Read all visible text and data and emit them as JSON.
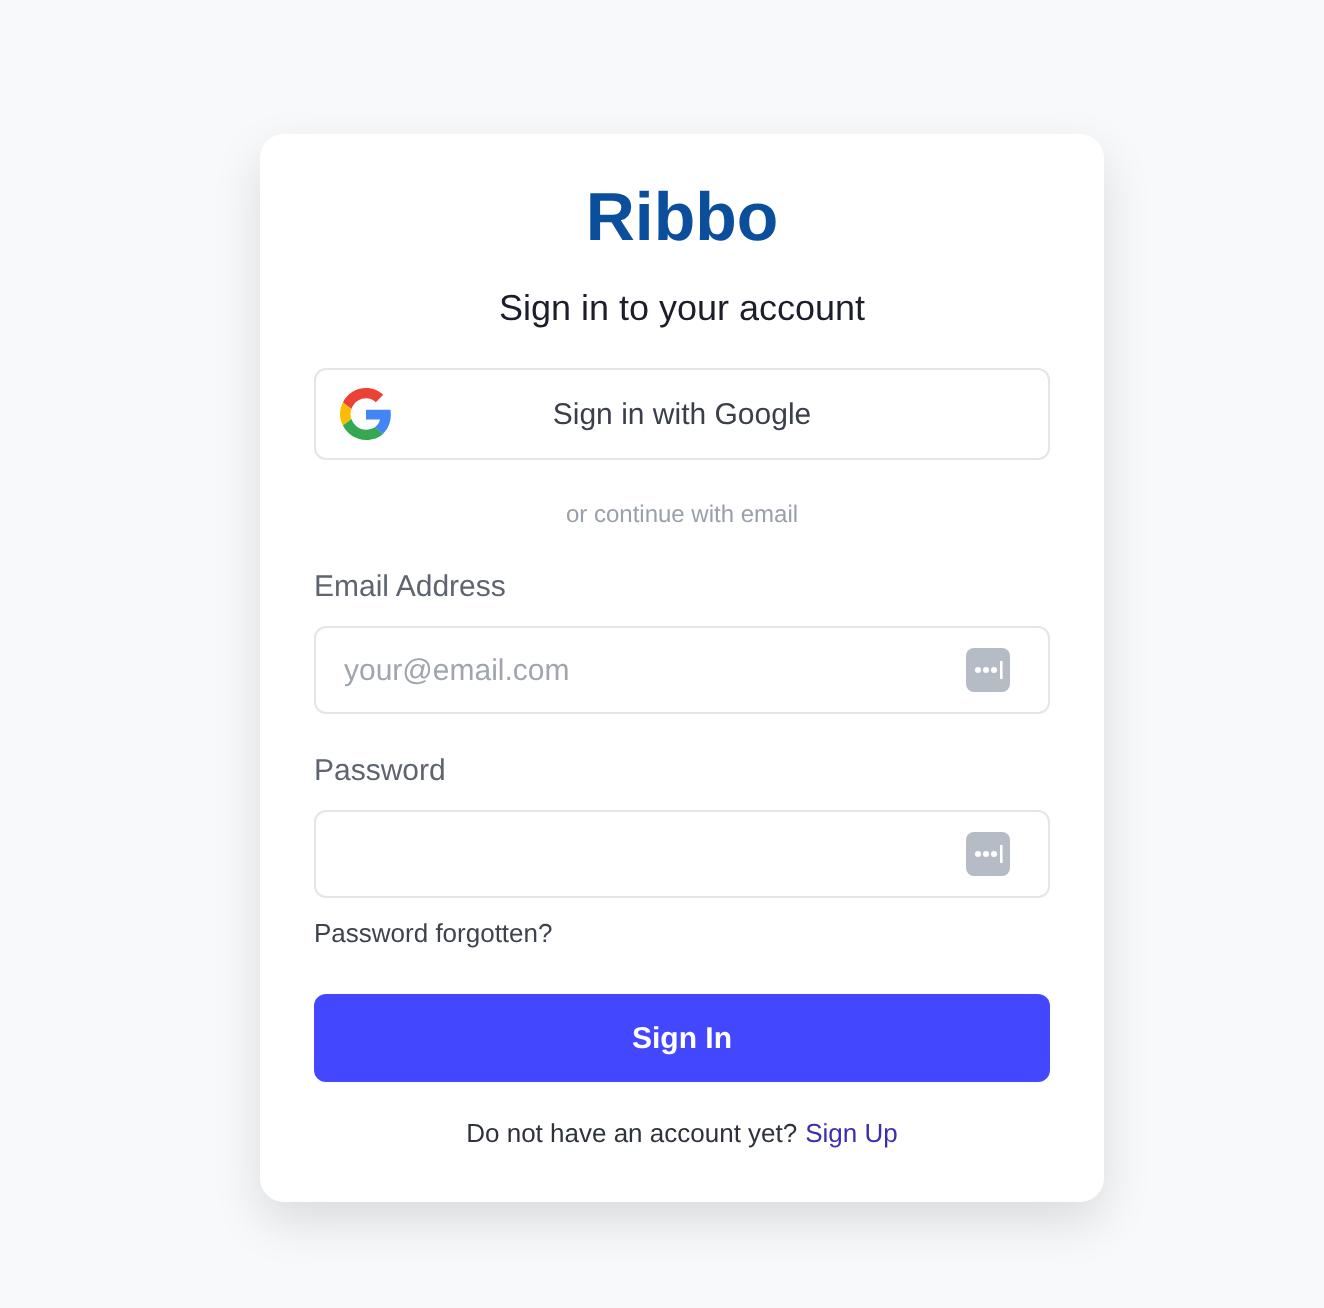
{
  "logo": "Ribbo",
  "title": "Sign in to your account",
  "google_button": "Sign in with Google",
  "divider": "or continue with email",
  "fields": [
    {
      "label": "Email Address",
      "placeholder": "your@email.com"
    },
    {
      "label": "Password"
    }
  ],
  "forgot_link": "Password forgotten?",
  "submit_button": "Sign In",
  "footer": {
    "text": "Do not have an account yet?",
    "link": "Sign Up"
  }
}
